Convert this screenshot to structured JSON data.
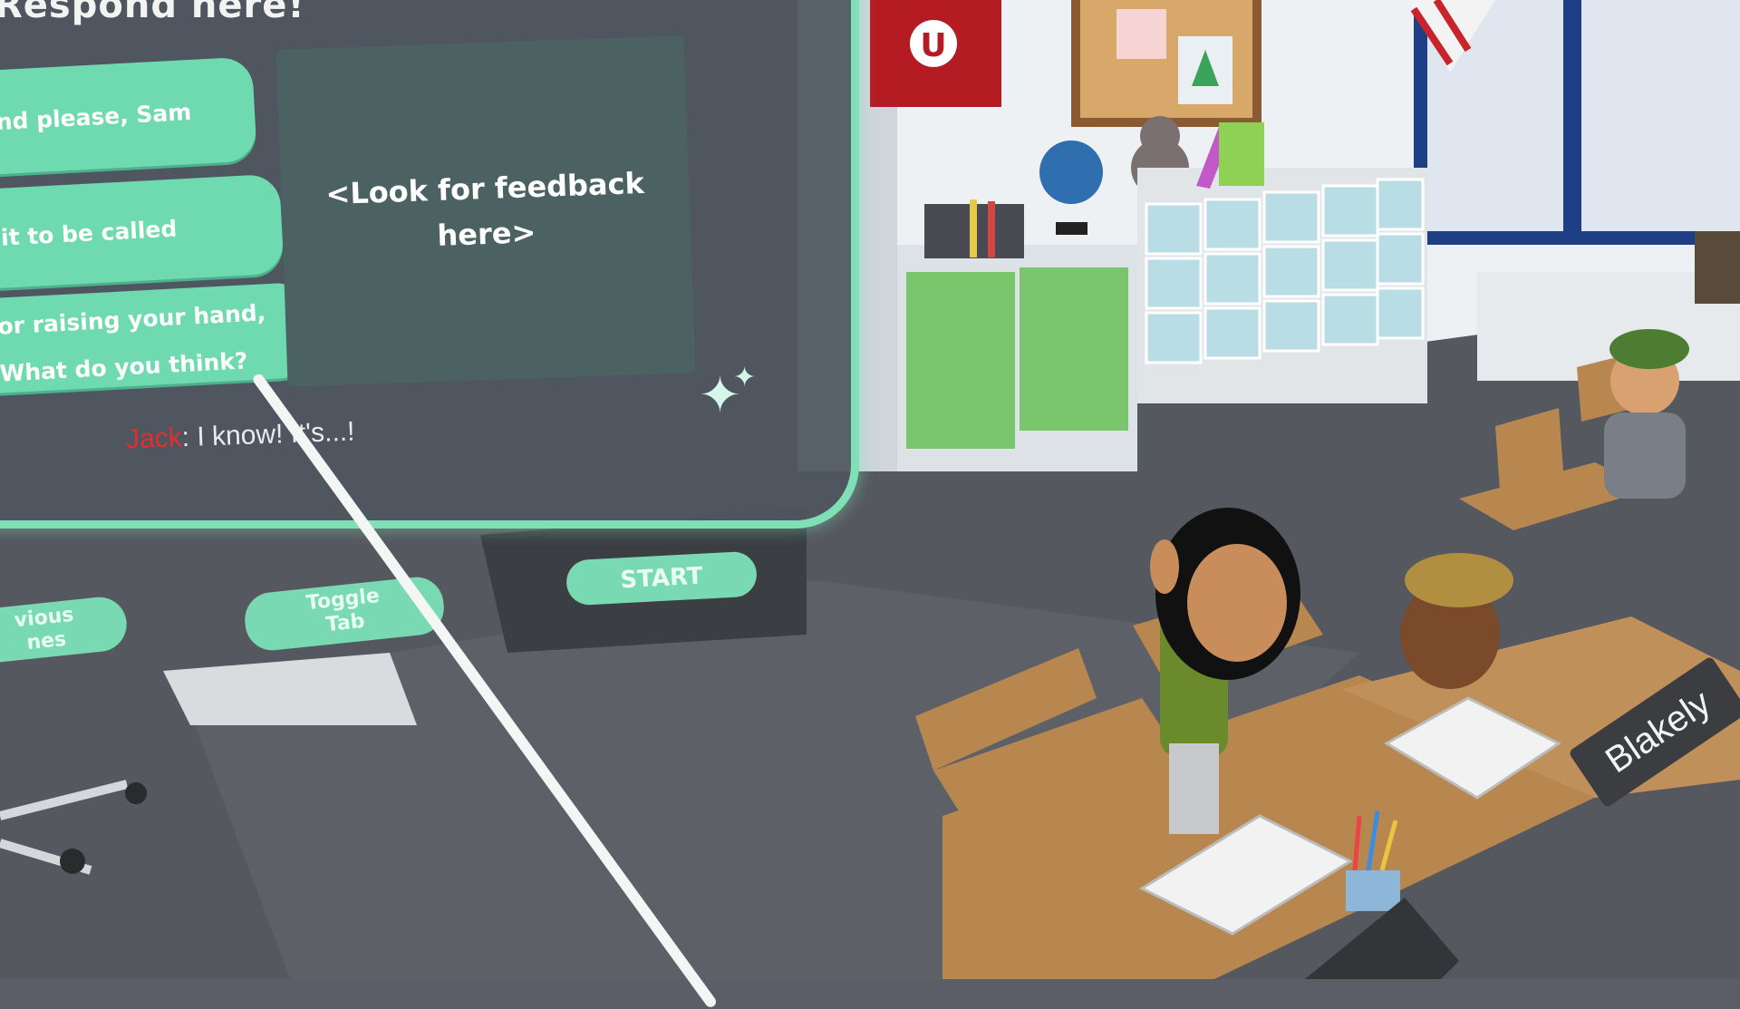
{
  "panel": {
    "title": "Respond here!",
    "options": [
      "hand please, Sam",
      "wait to be called",
      "u for raising your hand,",
      "a! What do you think?"
    ],
    "feedback_line1": "<Look for feedback",
    "feedback_line2": "here>",
    "chat": {
      "speaker": "Jack",
      "message": ": I know! It's...!"
    }
  },
  "buttons": {
    "start": "START",
    "toggle_line1": "Toggle",
    "toggle_line2": "Tab",
    "prev_line1": "vious",
    "prev_line2": "nes"
  },
  "scene": {
    "name_plate": "Blakely",
    "pennant": "U"
  },
  "colors": {
    "accent": "#7ee0b4",
    "panel": "#4e5660",
    "feedback_box": "#4c6262",
    "speaker": "#e02f2f"
  }
}
